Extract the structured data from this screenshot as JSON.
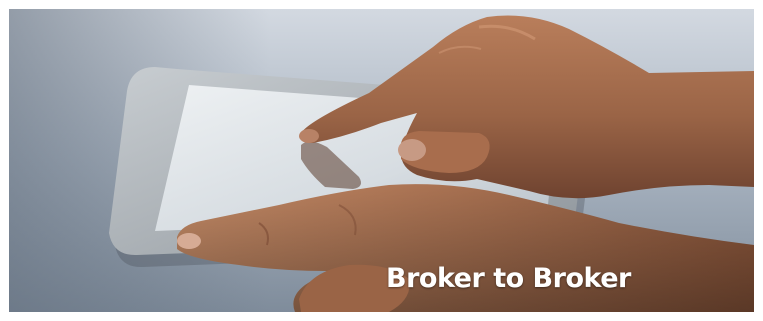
{
  "banner": {
    "caption": "Broker to Broker",
    "caption_color": "#ffffff",
    "background_color": "#ffffff"
  },
  "photo": {
    "subject_colors": {
      "skin": "#a9704e",
      "skin_shadow": "#6f4330",
      "tablet_bezel": "#b9bfc4",
      "tablet_screen": "#dfe4e8",
      "table_surface": "#9ca7b5"
    }
  }
}
